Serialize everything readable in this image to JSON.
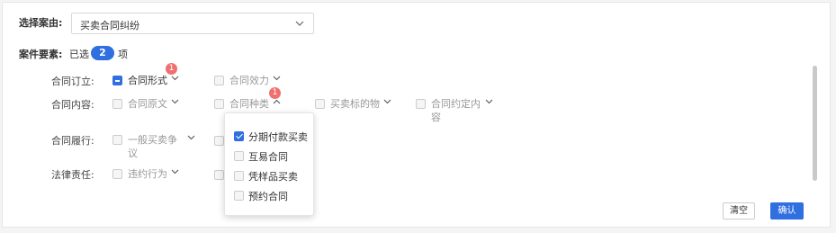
{
  "cause": {
    "label": "选择案由:",
    "value": "买卖合同纠纷"
  },
  "elements": {
    "label": "案件要素:",
    "selected_prefix": "已选",
    "count": "2",
    "unit": "项"
  },
  "rows": {
    "formation": {
      "label": "合同订立:",
      "items": [
        {
          "label": "合同形式",
          "badge": "1"
        },
        {
          "label": "合同效力"
        }
      ]
    },
    "content": {
      "label": "合同内容:",
      "items": [
        {
          "label": "合同原文"
        },
        {
          "label": "合同种类",
          "badge": "1"
        },
        {
          "label": "买卖标的物"
        },
        {
          "label": "合同约定内容"
        }
      ]
    },
    "performance": {
      "label": "合同履行:",
      "items": [
        {
          "label": "一般买卖争议"
        }
      ]
    },
    "liability": {
      "label": "法律责任:",
      "items": [
        {
          "label": "违约行为"
        }
      ]
    }
  },
  "dropdown": {
    "options": [
      {
        "label": "分期付款买卖",
        "checked": true
      },
      {
        "label": "互易合同",
        "checked": false
      },
      {
        "label": "凭样品买卖",
        "checked": false
      },
      {
        "label": "预约合同",
        "checked": false
      }
    ]
  },
  "buttons": {
    "clear": "清空",
    "confirm": "确认"
  },
  "icons": {
    "select_arrow": "chevron-down-icon",
    "item_arrow": "chevron-down-icon"
  },
  "colors": {
    "primary": "#2f6fe0",
    "badge": "#f07070",
    "border": "#d9d9d9"
  }
}
